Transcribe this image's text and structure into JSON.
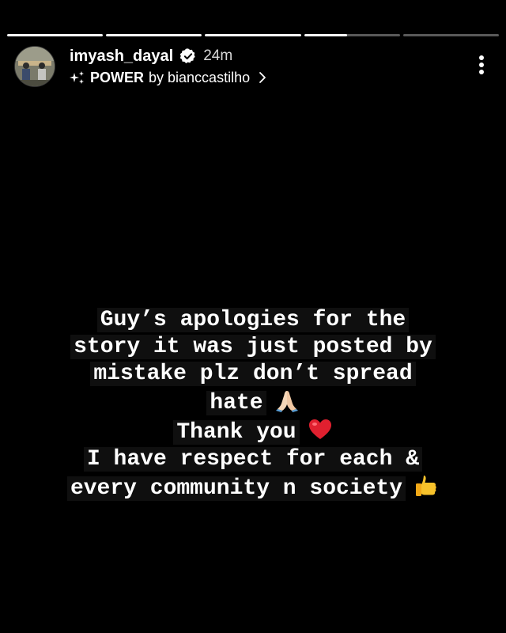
{
  "story": {
    "progress": [
      1,
      1,
      1,
      0.45,
      0
    ],
    "username": "imyash_dayal",
    "verified": true,
    "time": "24m",
    "music": {
      "song": "POWER",
      "by": "by bianccastilho"
    }
  },
  "caption": {
    "lines": [
      "Guy’s apologies for the",
      "story it was just posted by",
      "mistake plz don’t spread",
      "hate",
      "Thank you",
      "I have respect for each &",
      "every community n society"
    ]
  },
  "colors": {
    "background": "#000000",
    "text": "#ffffff",
    "heart": "#e0202f",
    "thumb": "#f7c22b"
  },
  "icons": {
    "verified": "verified-badge-icon",
    "music": "sparkle-music-icon",
    "chevron": "chevron-right-icon",
    "more": "more-vertical-icon"
  }
}
